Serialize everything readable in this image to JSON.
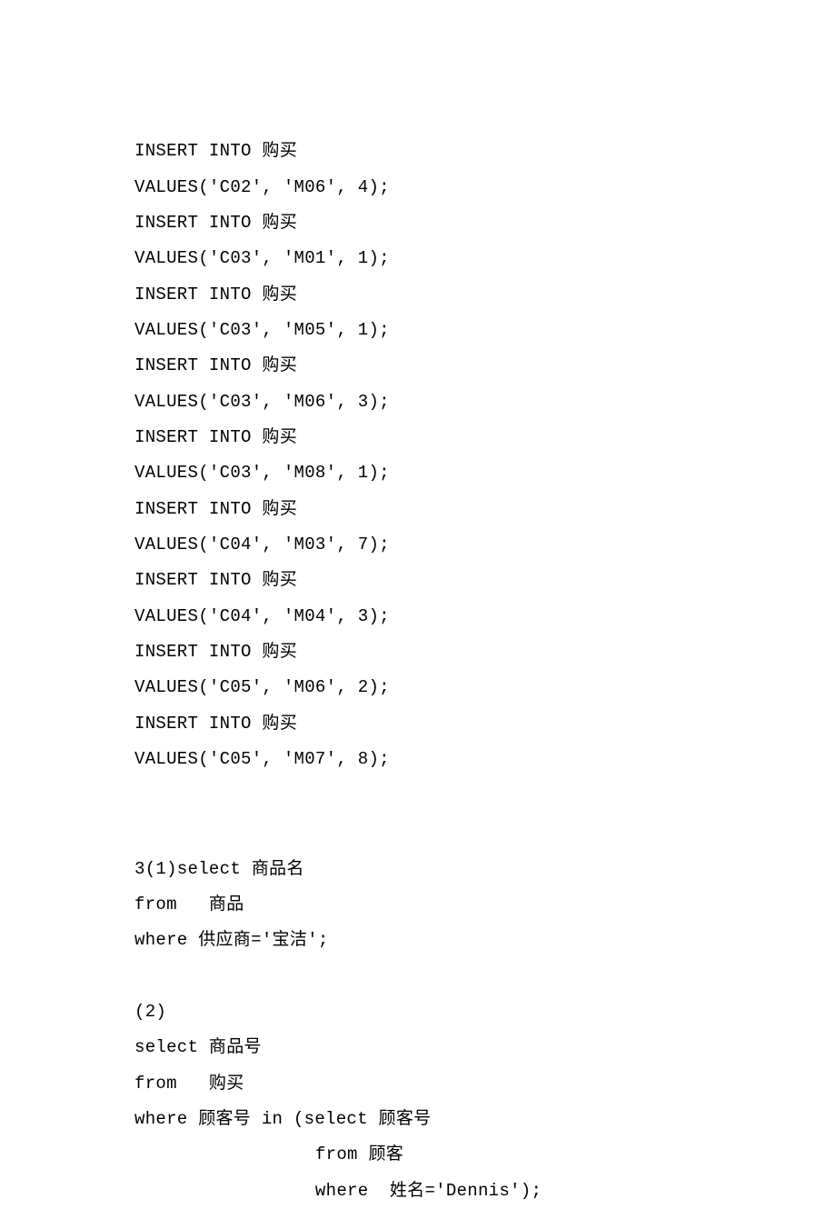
{
  "inserts": [
    {
      "line1": "INSERT INTO 购买",
      "line2": "VALUES('C02', 'M06', 4);"
    },
    {
      "line1": "INSERT INTO 购买",
      "line2": "VALUES('C03', 'M01', 1);"
    },
    {
      "line1": "INSERT INTO 购买",
      "line2": "VALUES('C03', 'M05', 1);"
    },
    {
      "line1": "INSERT INTO 购买",
      "line2": "VALUES('C03', 'M06', 3);"
    },
    {
      "line1": "INSERT INTO 购买",
      "line2": "VALUES('C03', 'M08', 1);"
    },
    {
      "line1": "INSERT INTO 购买",
      "line2": "VALUES('C04', 'M03', 7);"
    },
    {
      "line1": "INSERT INTO 购买",
      "line2": "VALUES('C04', 'M04', 3);"
    },
    {
      "line1": "INSERT INTO 购买",
      "line2": "VALUES('C05', 'M06', 2);"
    },
    {
      "line1": "INSERT INTO 购买",
      "line2": "VALUES('C05', 'M07', 8);"
    }
  ],
  "q1": {
    "l1": "3(1)select 商品名",
    "l2": "from   商品",
    "l3": "where 供应商='宝洁';"
  },
  "q2": {
    "l1": "(2)",
    "l2": "select 商品号",
    "l3": "from   购买",
    "l4": "where 顾客号 in (select 顾客号",
    "l5": "                 from 顾客",
    "l6": "                 where  姓名='Dennis');"
  }
}
